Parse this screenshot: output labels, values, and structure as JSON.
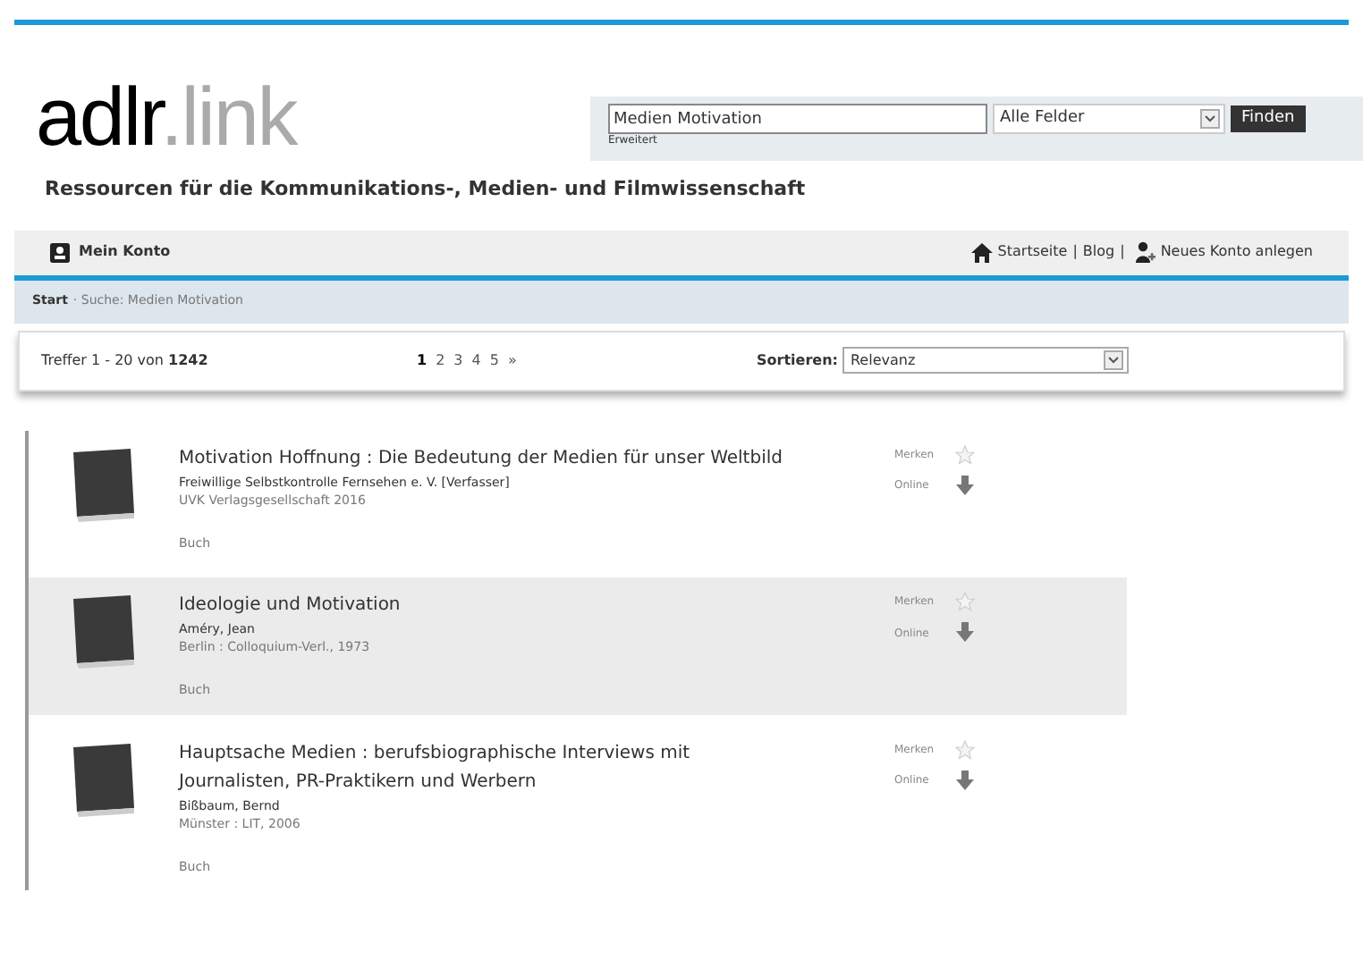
{
  "logo": {
    "main": "adlr",
    "suffix": ".link"
  },
  "tagline": "Ressourcen für die Kommunikations-, Medien- und Filmwissenschaft",
  "search": {
    "value": "Medien Motivation",
    "field": "Alle Felder",
    "button": "Finden",
    "advanced": "Erweitert"
  },
  "account": {
    "label": "Mein Konto"
  },
  "nav_links": [
    {
      "kind": "home",
      "label": "Startseite"
    },
    {
      "kind": "sep",
      "label": "|"
    },
    {
      "kind": "link",
      "label": "Blog"
    },
    {
      "kind": "sep",
      "label": "|"
    },
    {
      "kind": "user",
      "label": "Neues Konto anlegen"
    }
  ],
  "breadcrumb": {
    "start": "Start",
    "current": "· Suche: Medien Motivation"
  },
  "results_bar": {
    "count_prefix": "Treffer 1 - 20 von ",
    "count_total": "1242",
    "pages": [
      {
        "label": "1",
        "selected": true
      },
      {
        "label": "2",
        "selected": false
      },
      {
        "label": "3",
        "selected": false
      },
      {
        "label": "4",
        "selected": false
      },
      {
        "label": "5",
        "selected": false
      },
      {
        "label": "»",
        "selected": false
      }
    ],
    "sort_label": "Sortieren:",
    "sort_value": "Relevanz"
  },
  "results": [
    {
      "title": "Motivation Hoffnung : Die Bedeutung der Medien für unser Weltbild",
      "author": "Freiwillige Selbstkontrolle Fernsehen e. V. [Verfasser]",
      "publisher": "UVK Verlagsgesellschaft 2016",
      "type": "Buch",
      "save_label": "Merken",
      "online_label": "Online",
      "selected": false
    },
    {
      "title": "Ideologie und Motivation",
      "author": "Améry, Jean",
      "publisher": "Berlin : Colloquium-Verl., 1973",
      "type": "Buch",
      "save_label": "Merken",
      "online_label": "Online",
      "selected": true
    },
    {
      "title": "Hauptsache Medien : berufsbiographische Interviews mit Journalisten, PR-Praktikern und Werbern",
      "author": "Bißbaum, Bernd",
      "publisher": "Münster : LIT, 2006",
      "type": "Buch",
      "save_label": "Merken",
      "online_label": "Online",
      "selected": false
    }
  ]
}
